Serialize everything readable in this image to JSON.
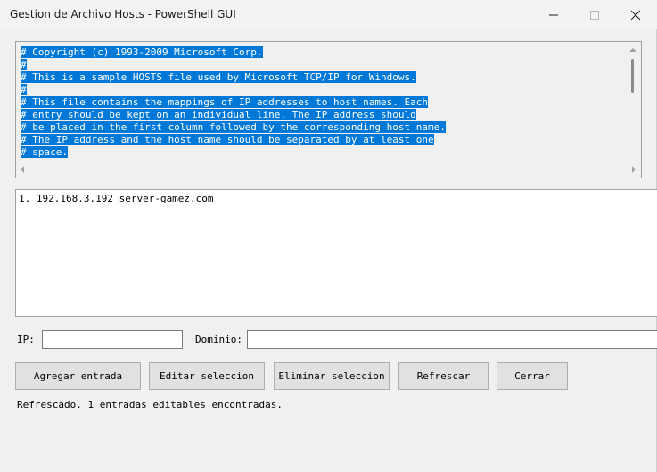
{
  "window": {
    "title": "Gestion de Archivo Hosts - PowerShell GUI"
  },
  "hosts_text": {
    "lines": [
      "# Copyright (c) 1993-2009 Microsoft Corp.",
      "#",
      "# This is a sample HOSTS file used by Microsoft TCP/IP for Windows.",
      "#",
      "# This file contains the mappings of IP addresses to host names. Each",
      "# entry should be kept on an individual line. The IP address should",
      "# be placed in the first column followed by the corresponding host name.",
      "# The IP address and the host name should be separated by at least one",
      "# space."
    ],
    "selection_color": "#0078d7"
  },
  "entries": {
    "items": [
      "1. 192.168.3.192 server-gamez.com"
    ]
  },
  "form": {
    "ip_label": "IP:",
    "ip_value": "",
    "domain_label": "Dominio:",
    "domain_value": ""
  },
  "buttons": {
    "add": "Agregar entrada",
    "edit": "Editar seleccion",
    "delete": "Eliminar seleccion",
    "refresh": "Refrescar",
    "close": "Cerrar"
  },
  "status": {
    "text": "Refrescado. 1 entradas editables encontradas."
  }
}
